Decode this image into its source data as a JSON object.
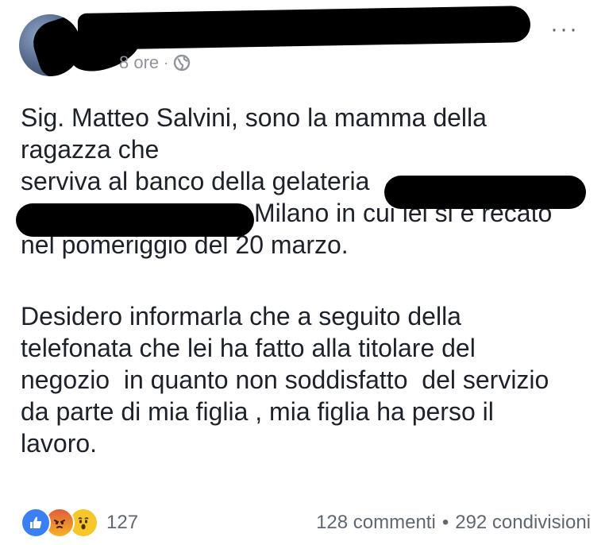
{
  "header": {
    "time": "8 ore",
    "separator": "·",
    "privacy_icon": "globe-icon",
    "more_icon": "more-options-icon",
    "more_label": "···"
  },
  "post": {
    "paragraph1_line1": "Sig. Matteo Salvini, sono la mamma della",
    "paragraph1_line2": "ragazza che",
    "paragraph1_line3": "serviva al banco della gelateria",
    "paragraph1_line4": "Milano in cui lei si è recato",
    "paragraph1_line5": "nel pomeriggio del 20 marzo.",
    "paragraph2_line1": "Desidero informarla che a seguito della",
    "paragraph2_line2": "telefonata che lei ha fatto alla titolare del",
    "paragraph2_line3": "negozio  in quanto non soddisfatto  del servizio",
    "paragraph2_line4": "da parte di mia figlia , mia figlia ha perso il",
    "paragraph2_line5": "lavoro."
  },
  "footer": {
    "reactions": [
      "like-icon",
      "angry-icon",
      "wow-icon"
    ],
    "reaction_count": "127",
    "comments": "128 commenti",
    "separator": "•",
    "shares": "292 condivisioni"
  },
  "colors": {
    "text": "#1d2129",
    "meta": "#90949c",
    "like": "#3b7ff5",
    "wow": "#f7c62b",
    "angry": "#e05d3a"
  }
}
